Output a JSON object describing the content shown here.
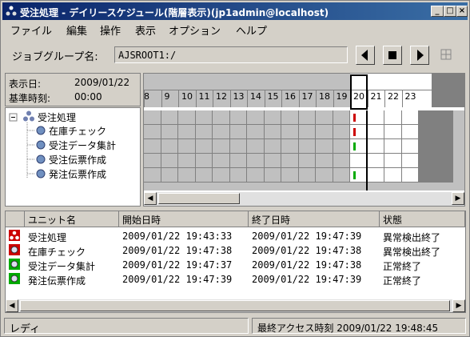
{
  "window": {
    "title": "受注処理 - デイリースケジュール(階層表示)(jp1admin@localhost)",
    "min": "_",
    "max": "□",
    "close": "×"
  },
  "menu": [
    "ファイル",
    "編集",
    "操作",
    "表示",
    "オプション",
    "ヘルプ"
  ],
  "toolbar": {
    "label": "ジョブグループ名:",
    "path": "AJSROOT1:/"
  },
  "info": {
    "date_label": "表示日:",
    "date": "2009/01/22",
    "time_label": "基準時刻:",
    "time": "00:00"
  },
  "tree": {
    "root": "受注処理",
    "children": [
      "在庫チェック",
      "受注データ集計",
      "受注伝票作成",
      "発注伝票作成"
    ],
    "expander": "−"
  },
  "hours": [
    "8",
    "9",
    "10",
    "11",
    "12",
    "13",
    "14",
    "15",
    "16",
    "17",
    "18",
    "19",
    "20",
    "21",
    "22",
    "23"
  ],
  "list": {
    "headers": [
      "ユニット名",
      "開始日時",
      "終了日時",
      "状態"
    ],
    "rows": [
      {
        "name": "受注処理",
        "start": "2009/01/22 19:43:33",
        "end": "2009/01/22 19:47:39",
        "status": "異常検出終了",
        "color": "#cc0000",
        "icon": "jobnet-icon"
      },
      {
        "name": "在庫チェック",
        "start": "2009/01/22 19:47:38",
        "end": "2009/01/22 19:47:38",
        "status": "異常検出終了",
        "color": "#cc0000",
        "icon": "job-icon"
      },
      {
        "name": "受注データ集計",
        "start": "2009/01/22 19:47:37",
        "end": "2009/01/22 19:47:38",
        "status": "正常終了",
        "color": "#00aa00",
        "icon": "job-icon"
      },
      {
        "name": "発注伝票作成",
        "start": "2009/01/22 19:47:39",
        "end": "2009/01/22 19:47:39",
        "status": "正常終了",
        "color": "#00aa00",
        "icon": "job-icon"
      }
    ]
  },
  "status": {
    "left": "レディ",
    "right": "最終アクセス時刻 2009/01/22 19:48:45"
  }
}
